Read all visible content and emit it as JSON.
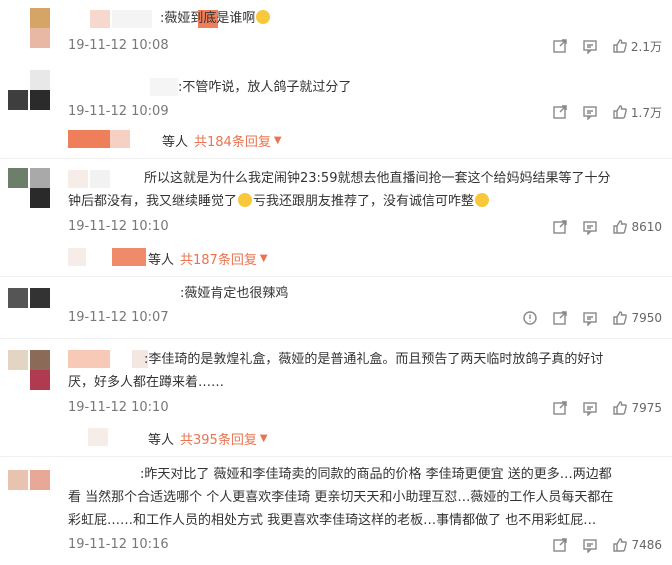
{
  "comments": [
    {
      "text": ":薇娅到底是谁啊",
      "time": "19-11-12 10:08",
      "likes": "2.1万"
    },
    {
      "text": ":不管咋说，放人鸽子就过分了",
      "time": "19-11-12 10:09",
      "likes": "1.7万",
      "reply_prefix": "等人",
      "reply_link": "共184条回复"
    },
    {
      "text_line1": "所以这就是为什么我定闹钟23:59就想去他直播间抢一套这个给妈妈结果等了十分",
      "text_line2a": "钟后都没有，我又继续睡觉了",
      "text_line2b": "亏我还跟朋友推荐了，没有诚信可咋整",
      "time": "19-11-12 10:10",
      "likes": "8610",
      "reply_prefix": "等人",
      "reply_link": "共187条回复"
    },
    {
      "text": ":薇娅肯定也很辣鸡",
      "time": "19-11-12 10:07",
      "likes": "7950"
    },
    {
      "text_line1": ":李佳琦的是敦煌礼盒，薇娅的是普通礼盒。而且预告了两天临时放鸽子真的好讨",
      "text_line2": "厌，好多人都在蹲来着……",
      "time": "19-11-12 10:10",
      "likes": "7975",
      "reply_prefix": "等人",
      "reply_link": "共395条回复"
    },
    {
      "text_line1": ":昨天对比了 薇娅和李佳琦卖的同款的商品的价格 李佳琦更便宜 送的更多…两边都",
      "text_line2": "看 当然那个合适选哪个 个人更喜欢李佳琦 更亲切天天和小助理互怼…薇娅的工作人员每天都在",
      "text_line3": "彩虹屁……和工作人员的相处方式 我更喜欢李佳琦这样的老板…事情都做了 也不用彩虹屁…",
      "time": "19-11-12 10:16",
      "likes": "7486"
    }
  ],
  "icons": [
    "share-icon",
    "comment-icon",
    "like-icon",
    "report-icon"
  ],
  "colors": {
    "accent": "#eb7350",
    "meta": "#777777"
  }
}
